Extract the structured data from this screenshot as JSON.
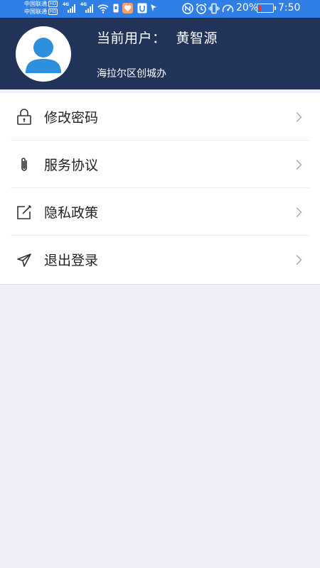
{
  "status_bar": {
    "carrier_1": "中国联通",
    "carrier_2": "中国联通",
    "hd_badge": "HD",
    "network_1": "4G",
    "network_2": "4G",
    "battery_percent": "20%",
    "time": "7:50",
    "icons": [
      "signal-icon",
      "wifi-icon",
      "sim-icon",
      "health-app-icon",
      "vpn-icon",
      "location-icon",
      "nfc-icon",
      "alarm-icon",
      "vibrate-icon",
      "speed-icon",
      "battery-icon"
    ],
    "battery_level": 0.2,
    "colors": {
      "background": "#2f7fe6",
      "battery_low": "#e53935"
    }
  },
  "header": {
    "user_label": "当前用户：",
    "user_name": "黄智源",
    "organization": "海拉尔区创城办",
    "avatar_icon": "person-avatar-icon",
    "colors": {
      "background": "#22335a",
      "avatar": "#2e8fdc"
    }
  },
  "menu": {
    "items": [
      {
        "label": "修改密码",
        "icon": "lock-icon"
      },
      {
        "label": "服务协议",
        "icon": "paperclip-icon"
      },
      {
        "label": "隐私政策",
        "icon": "edit-icon"
      },
      {
        "label": "退出登录",
        "icon": "send-icon"
      }
    ]
  },
  "colors": {
    "page_background": "#efeff7"
  }
}
